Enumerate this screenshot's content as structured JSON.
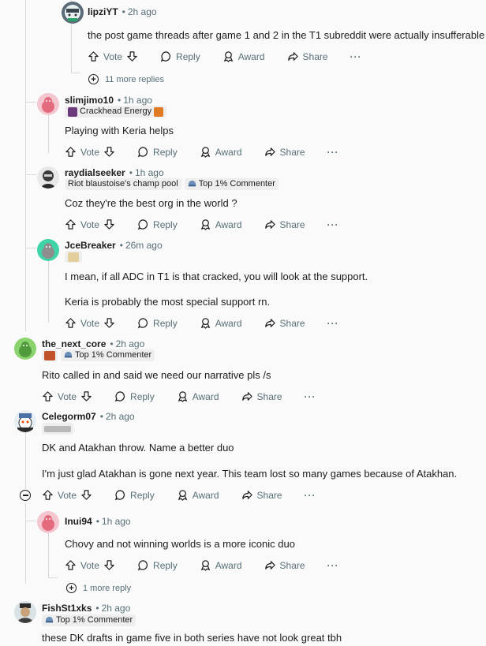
{
  "comments": [
    {
      "id": "c1",
      "user": "lipziYT",
      "time": "2h ago",
      "text": [
        "the post game threads after game 1 and 2 in the T1 subreddit were actually insufferable"
      ],
      "flairs": []
    },
    {
      "id": "c2",
      "user": "slimjimo10",
      "time": "1h ago",
      "text": [
        "Playing with Keria helps"
      ],
      "flairs": [
        {
          "label": "Crackhead Energy"
        }
      ]
    },
    {
      "id": "c3",
      "user": "raydialseeker",
      "time": "1h ago",
      "text": [
        "Coz they're the best org in the world ?"
      ],
      "flairs": [
        {
          "label": "Riot blaustoise's champ pool"
        },
        {
          "label": "Top 1% Commenter"
        }
      ]
    },
    {
      "id": "c4",
      "user": "JceBreaker",
      "time": "26m ago",
      "text": [
        "I mean, if all ADC in T1 is that cracked, you will look at the support.",
        "Keria is probably the most special support rn."
      ],
      "flairs": []
    },
    {
      "id": "c5",
      "user": "the_next_core",
      "time": "2h ago",
      "text": [
        "Rito called in and said we need our narrative pls /s"
      ],
      "flairs": [
        {
          "label": "Top 1% Commenter"
        }
      ]
    },
    {
      "id": "c6",
      "user": "Celegorm07",
      "time": "2h ago",
      "text": [
        "DK and Atakhan throw. Name a better duo",
        "I'm just glad Atakhan is gone next year. This team lost so many games because of Atakhan."
      ],
      "flairs": []
    },
    {
      "id": "c7",
      "user": "Inui94",
      "time": "1h ago",
      "text": [
        "Chovy and not winning worlds is a more iconic duo"
      ],
      "flairs": []
    },
    {
      "id": "c8",
      "user": "FishSt1xks",
      "time": "2h ago",
      "text": [
        "these DK drafts in game five in both series have not look great tbh"
      ],
      "flairs": [
        {
          "label": "Top 1% Commenter"
        }
      ]
    }
  ],
  "actions": {
    "vote": "Vote",
    "reply": "Reply",
    "award": "Award",
    "share": "Share",
    "more": "···"
  },
  "more_replies": {
    "c1": "11 more replies",
    "c7": "1 more reply"
  },
  "colors": {
    "text": "#1c1c1c",
    "muted": "#576f76",
    "thread_line": "#d7dadc",
    "flair_bg": "#eeeeef",
    "background": "#fafafa"
  }
}
